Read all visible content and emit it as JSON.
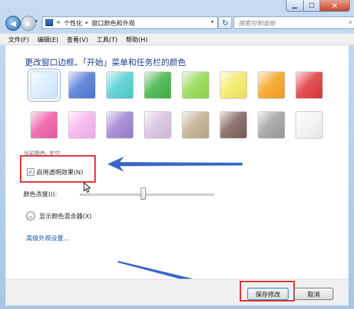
{
  "window": {
    "caption_buttons": {
      "minimize": "▁",
      "maximize": "□",
      "close": "✕"
    }
  },
  "navigation": {
    "back_glyph": "◀",
    "forward_glyph": "▶",
    "history_glyph": "▾",
    "address_overflow": "«",
    "breadcrumb": [
      "个性化",
      "窗口颜色和外观"
    ],
    "breadcrumb_separator": "▸",
    "address_dropdown": "▾",
    "refresh_glyph": "↻",
    "search_placeholder": "搜索控制面板",
    "search_glyph": "⌕"
  },
  "menubar": [
    {
      "label": "文件(F)"
    },
    {
      "label": "编辑(E)"
    },
    {
      "label": "查看(V)"
    },
    {
      "label": "工具(T)"
    },
    {
      "label": "帮助(H)"
    }
  ],
  "main": {
    "heading": "更改窗口边框、「开始」菜单和任务栏的颜色",
    "swatches_row1": [
      "#d7ecff",
      "#4d78d6",
      "#4fd0d2",
      "#41b447",
      "#93da4f",
      "#f4ea63",
      "#f6a21c",
      "#e0343a"
    ],
    "swatches_row2": [
      "#f05aa7",
      "#f7b3ee",
      "#9e7fd2",
      "#d6c2de",
      "#bfae8d",
      "#7d5f5c",
      "#9f9f9f",
      "#f3f3f3"
    ],
    "current_color_label": "当前颜色: 天空",
    "transparency": {
      "checked": true,
      "label": "启用透明效果(N)",
      "check_glyph": "✓"
    },
    "intensity_label": "颜色浓度(I):",
    "intensity_value": 0.47,
    "mixer": {
      "label": "显示颜色混合器(X)",
      "glyph": "⌄"
    },
    "advanced_link": "高级外观设置..."
  },
  "footer": {
    "save_label": "保存修改",
    "cancel_label": "取消"
  },
  "annotation_color": "#e0262b",
  "arrow_color": "#3a67c9"
}
